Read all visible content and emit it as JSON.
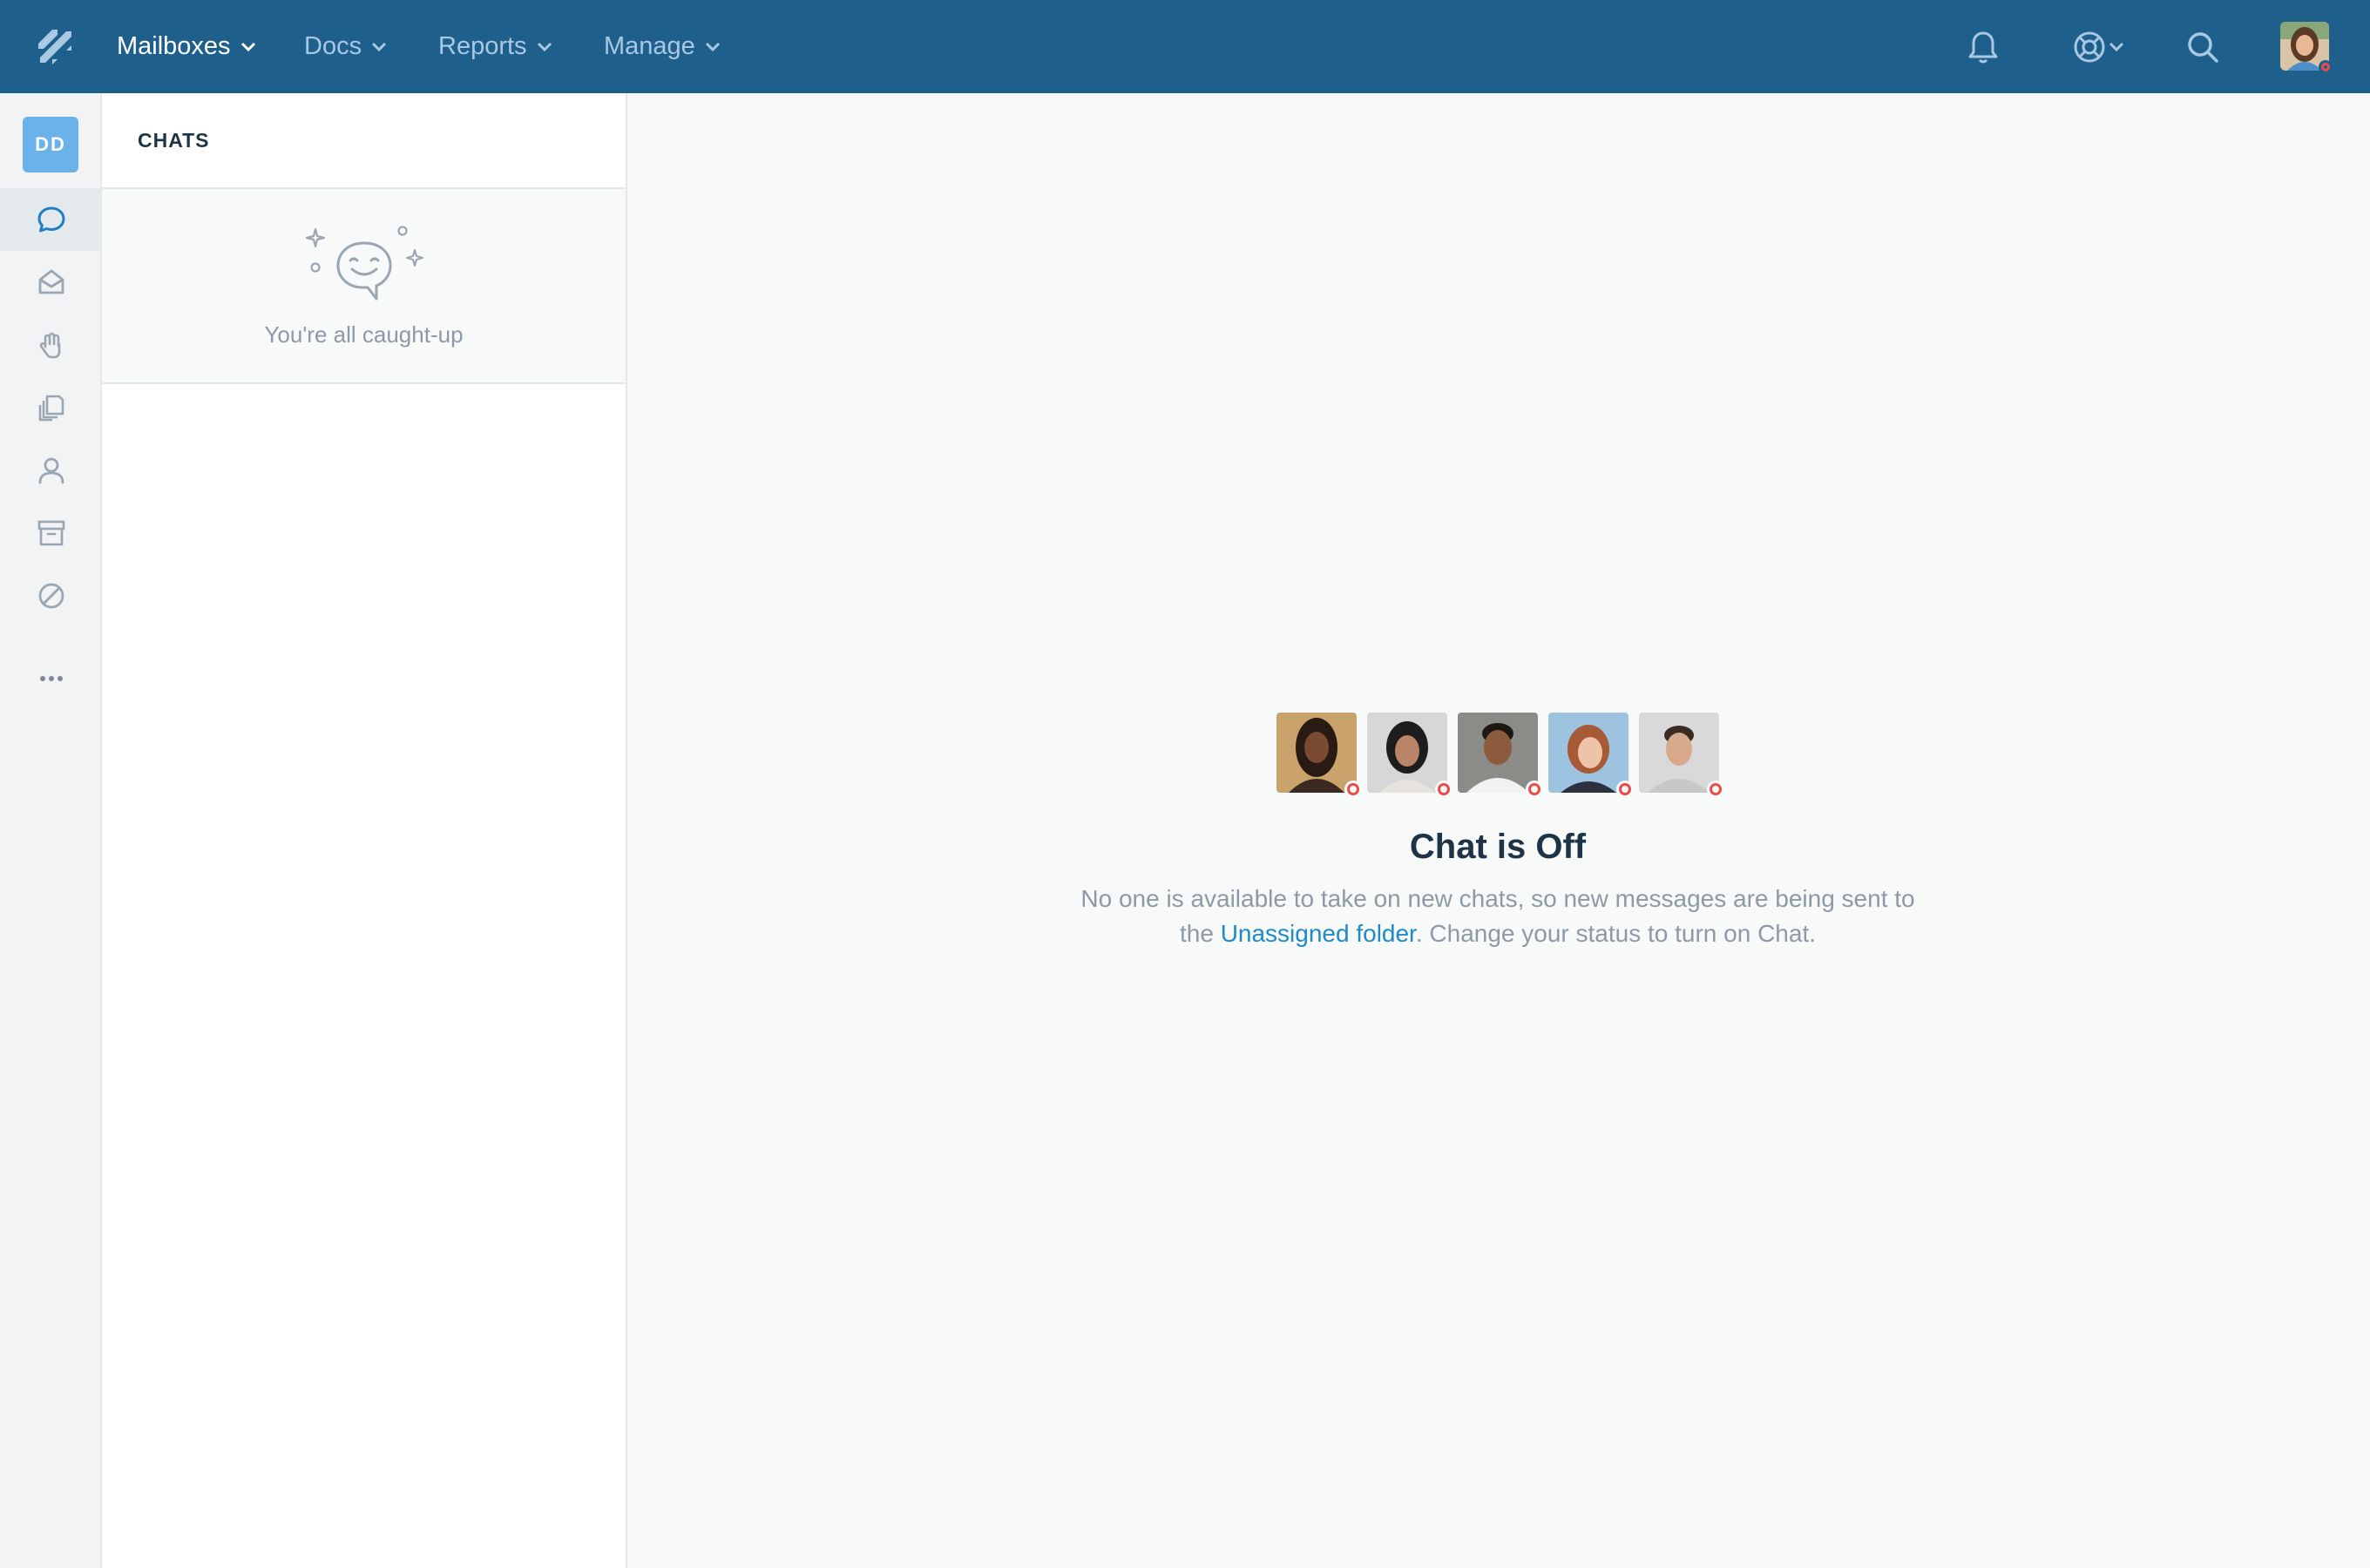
{
  "nav": {
    "items": [
      {
        "label": "Mailboxes"
      },
      {
        "label": "Docs"
      },
      {
        "label": "Reports"
      },
      {
        "label": "Manage"
      }
    ],
    "icons": [
      "bell-icon",
      "help-lifebuoy-icon",
      "search-icon"
    ],
    "user_status_color": "#ee4a4a",
    "bar_color": "#1f5f8b"
  },
  "rail": {
    "initials": "DD",
    "items": [
      "chat-icon",
      "inbox-icon",
      "hand-icon",
      "documents-icon",
      "person-icon",
      "archive-icon",
      "blocked-icon",
      "more-icon"
    ]
  },
  "chats": {
    "header": "CHATS",
    "empty_text": "You're all caught-up"
  },
  "main": {
    "title": "Chat is Off",
    "desc_before": "No one is available to take on new chats, so new messages are being sent to",
    "desc_line2_prefix": "the ",
    "desc_link": "Unassigned folder",
    "desc_after": ". Change your status to turn on Chat.",
    "link_color": "#1f8ac8",
    "away_color": "#ee4a4a"
  }
}
